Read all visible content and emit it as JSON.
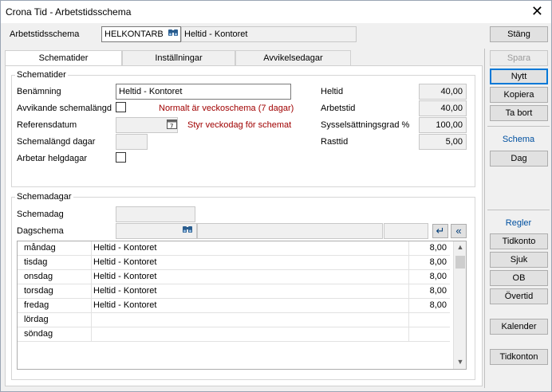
{
  "window": {
    "title": "Crona Tid - Arbetstidsschema",
    "close_glyph": "✕"
  },
  "header": {
    "schema_label": "Arbetstidsschema",
    "schema_code": "HELKONTARB",
    "schema_name": "Heltid - Kontoret",
    "close_button": "Stäng"
  },
  "tabs": [
    "Schematider",
    "Inställningar",
    "Avvikelsedagar"
  ],
  "schematider": {
    "legend": "Schematider",
    "benamning_label": "Benämning",
    "benamning_value": "Heltid - Kontoret",
    "avvikande_label": "Avvikande schemalängd",
    "avvikande_note": "Normalt är veckoschema (7 dagar)",
    "referensdatum_label": "Referensdatum",
    "referensdatum_value": "",
    "referensdatum_note": "Styr veckodag för schemat",
    "schemalangd_label": "Schemalängd dagar",
    "schemalangd_value": "",
    "helgdagar_label": "Arbetar helgdagar",
    "heltid_label": "Heltid",
    "heltid_value": "40,00",
    "arbetstid_label": "Arbetstid",
    "arbetstid_value": "40,00",
    "syss_label": "Sysselsättningsgrad %",
    "syss_value": "100,00",
    "rasttid_label": "Rasttid",
    "rasttid_value": "5,00"
  },
  "schemadagar": {
    "legend": "Schemadagar",
    "schemadag_label": "Schemadag",
    "schemadag_value": "",
    "dagschema_label": "Dagschema",
    "rows": [
      {
        "day": "måndag",
        "schema": "Heltid - Kontoret",
        "hours": "8,00"
      },
      {
        "day": "tisdag",
        "schema": "Heltid - Kontoret",
        "hours": "8,00"
      },
      {
        "day": "onsdag",
        "schema": "Heltid - Kontoret",
        "hours": "8,00"
      },
      {
        "day": "torsdag",
        "schema": "Heltid - Kontoret",
        "hours": "8,00"
      },
      {
        "day": "fredag",
        "schema": "Heltid - Kontoret",
        "hours": "8,00"
      },
      {
        "day": "lördag",
        "schema": "",
        "hours": ""
      },
      {
        "day": "söndag",
        "schema": "",
        "hours": ""
      }
    ]
  },
  "side": {
    "spara": "Spara",
    "nytt": "Nytt",
    "kopiera": "Kopiera",
    "ta_bort": "Ta bort",
    "schema_head": "Schema",
    "dag": "Dag",
    "regler_head": "Regler",
    "tidkonto": "Tidkonto",
    "sjuk": "Sjuk",
    "ob": "OB",
    "overtid": "Övertid",
    "kalender": "Kalender",
    "tidkonton": "Tidkonton"
  },
  "icons": {
    "binoculars": "binoculars-icon",
    "calendar": "calendar-icon",
    "enter": "enter-arrow-icon",
    "collapse": "double-chevron-left-icon",
    "scroll_up": "scroll-up-icon",
    "scroll_down": "scroll-down-icon"
  },
  "colors": {
    "note_red": "#a00000",
    "side_head_blue": "#0050a0",
    "focus_blue": "#0078d7"
  }
}
